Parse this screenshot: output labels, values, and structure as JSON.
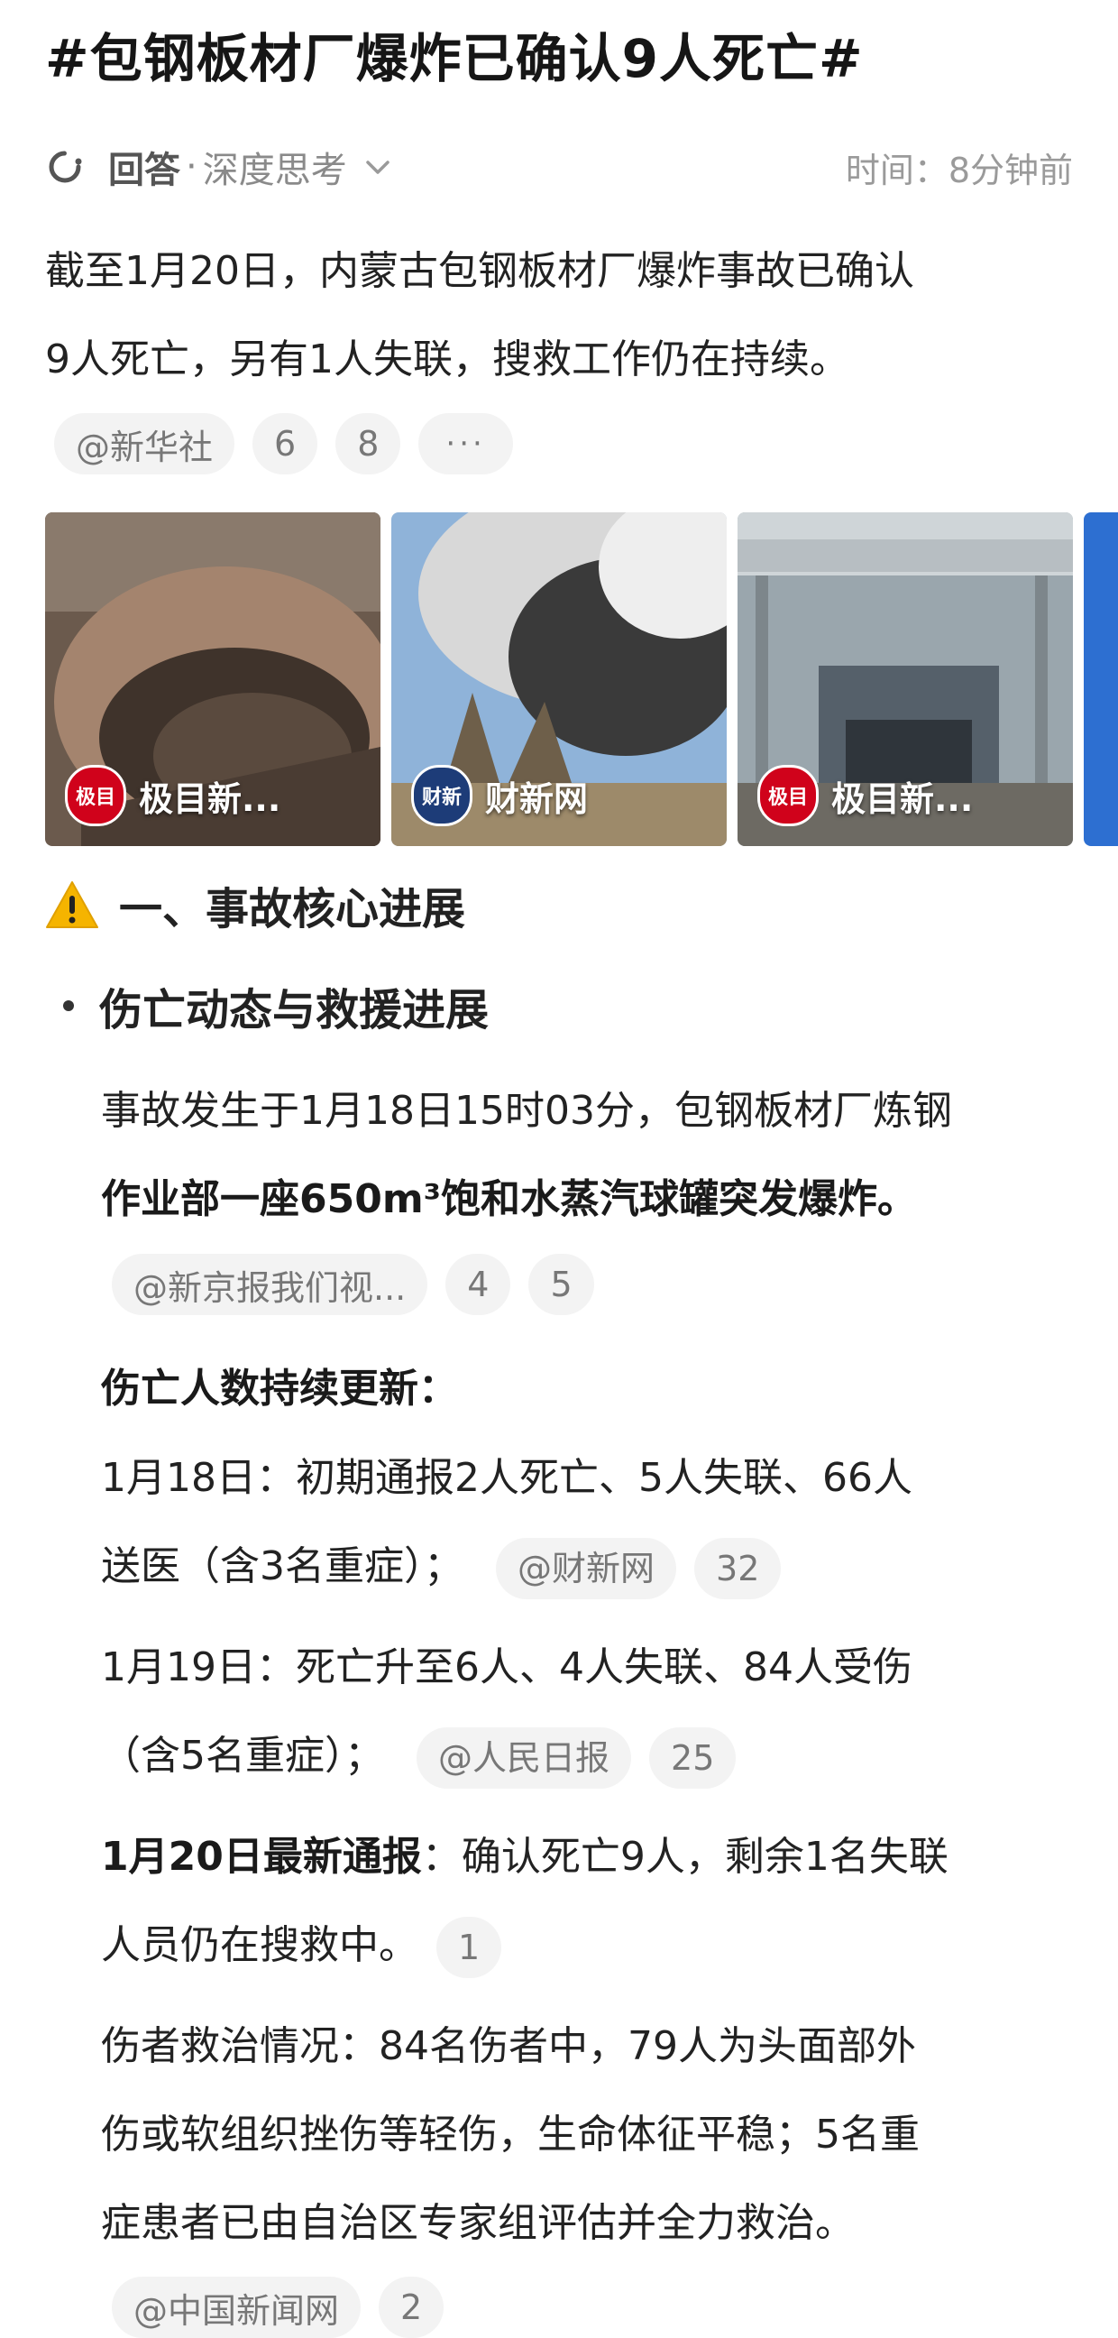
{
  "header": {
    "title": "#包钢板材厂爆炸已确认9人死亡#"
  },
  "answer": {
    "label": "回答",
    "separator": "·",
    "mode": "深度思考",
    "time": "时间：8分钟前"
  },
  "summary": {
    "line1": "截至1月20日，内蒙古包钢板材厂爆炸事故已确认",
    "line2": "9人死亡，另有1人失联，搜救工作仍在持续。",
    "chips": [
      "@新华社",
      "6",
      "8",
      "···"
    ]
  },
  "gallery": [
    {
      "source": "极目新...",
      "logo_text": "极目"
    },
    {
      "source": "财新网",
      "logo_text": "财新"
    },
    {
      "source": "极目新...",
      "logo_text": "极目"
    }
  ],
  "section1": {
    "title": "一、事故核心进展"
  },
  "bullet1": {
    "title": "伤亡动态与救援进展"
  },
  "event": {
    "line1": "事故发生于1月18日15时03分，包钢板材厂炼钢",
    "line2": "作业部一座650m³饱和水蒸汽球罐突发爆炸。",
    "chips": [
      "@新京报我们视...",
      "4",
      "5"
    ]
  },
  "casualty": {
    "heading": "伤亡人数持续更新：",
    "d18_line1": "1月18日：初期通报2人死亡、5人失联、66人",
    "d18_line2": "送医（含3名重症）；",
    "d18_chips": [
      "@财新网",
      "32"
    ],
    "d19_line1": "1月19日：死亡升至6人、4人失联、84人受伤",
    "d19_line2": "（含5名重症）；",
    "d19_chips": [
      "@人民日报",
      "25"
    ],
    "d20_bold": "1月20日最新通报",
    "d20_rest": "：确认死亡9人，剩余1名失联",
    "d20_line2": "人员仍在搜救中。",
    "d20_chips": [
      "1"
    ]
  },
  "treatment": {
    "line1": "伤者救治情况：84名伤者中，79人为头面部外",
    "line2": "伤或软组织挫伤等轻伤，生命体征平稳；5名重",
    "line3": "症患者已由自治区专家组评估并全力救治。",
    "chips": [
      "@中国新闻网",
      "2"
    ]
  },
  "colors": {
    "warning": "#F5B400",
    "chip_bg": "#F3F3F3",
    "text": "#222222",
    "muted": "#8A8A8A"
  }
}
